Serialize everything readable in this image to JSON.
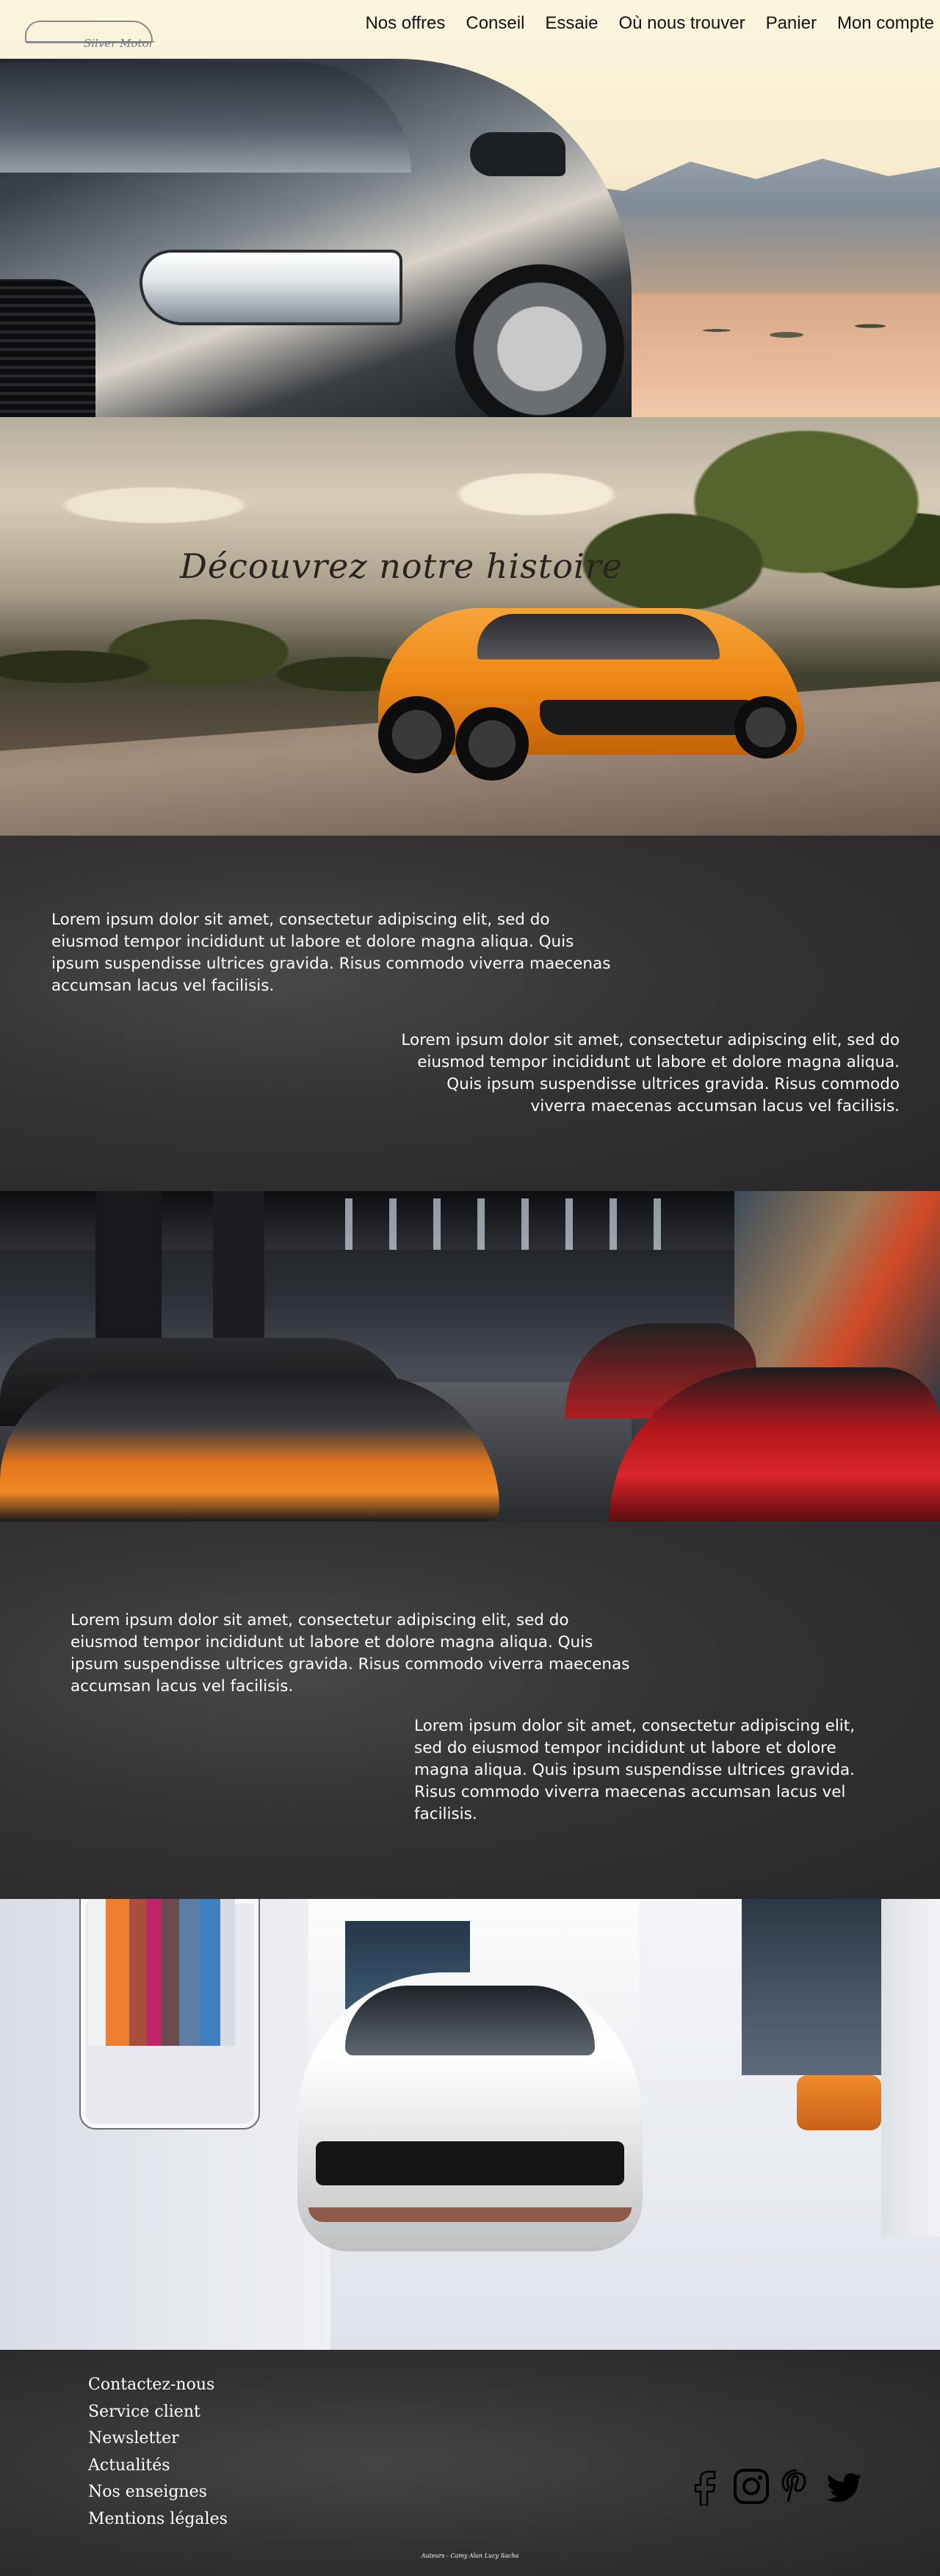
{
  "brand": {
    "logo_text": "Silver Motor"
  },
  "nav": {
    "items": [
      "Nos offres",
      "Conseil",
      "Essaie",
      "Où nous trouver",
      "Panier",
      "Mon compte"
    ]
  },
  "history": {
    "title": "Découvrez notre histoire"
  },
  "section1": {
    "paragraph_left": "Lorem ipsum dolor sit amet, consectetur adipiscing elit, sed do eiusmod tempor incididunt ut labore et dolore magna aliqua. Quis ipsum suspendisse ultrices gravida. Risus commodo viverra maecenas accumsan lacus vel facilisis.",
    "paragraph_right": "Lorem ipsum dolor sit amet, consectetur adipiscing elit, sed do eiusmod tempor incididunt ut labore et dolore magna aliqua. Quis ipsum suspendisse ultrices gravida. Risus commodo viverra maecenas accumsan lacus vel facilisis."
  },
  "section2": {
    "paragraph_left": "Lorem ipsum dolor sit amet, consectetur adipiscing elit, sed do eiusmod tempor incididunt ut labore et dolore magna aliqua. Quis ipsum suspendisse ultrices gravida. Risus commodo viverra maecenas accumsan lacus vel facilisis.",
    "paragraph_right": "Lorem ipsum dolor sit amet, consectetur adipiscing elit, sed do eiusmod tempor incididunt ut labore et dolore magna aliqua. Quis ipsum suspendisse ultrices gravida. Risus commodo viverra maecenas accumsan lacus vel facilisis."
  },
  "footer": {
    "links": [
      "Contactez-nous",
      "Service client",
      "Newsletter",
      "Actualités",
      "Nos enseignes",
      "Mentions légales"
    ],
    "social": [
      "facebook-icon",
      "instagram-icon",
      "pinterest-icon",
      "twitter-icon"
    ],
    "credit": "Auteurs - Camy Alan Lucy Sacha"
  }
}
